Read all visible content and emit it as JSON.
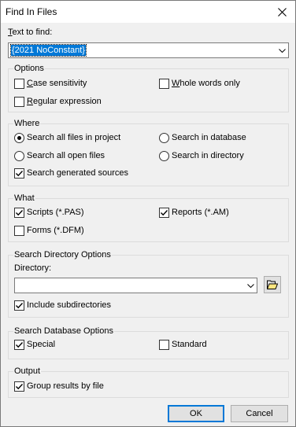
{
  "window": {
    "title": "Find In Files"
  },
  "find": {
    "label_prefix": "",
    "label_ul": "T",
    "label_rest": "ext to find:",
    "value": "{2021 NoConstant}"
  },
  "options": {
    "title": "Options",
    "case": {
      "ul": "C",
      "rest": "ase sensitivity",
      "checked": false
    },
    "whole": {
      "ul": "W",
      "rest": "hole words only",
      "checked": false
    },
    "regex": {
      "ul": "R",
      "rest": "egular expression",
      "checked": false
    }
  },
  "where": {
    "title": "Where",
    "all_project": {
      "label": "Search all files in project",
      "selected": true
    },
    "open_files": {
      "label": "Search all open files",
      "selected": false
    },
    "generated": {
      "label": "Search generated sources",
      "checked": true
    },
    "database": {
      "label": "Search in database",
      "selected": false
    },
    "directory": {
      "label": "Search in directory",
      "selected": false
    }
  },
  "what": {
    "title": "What",
    "scripts": {
      "label": "Scripts (*.PAS)",
      "checked": true
    },
    "reports": {
      "label": "Reports (*.AM)",
      "checked": true
    },
    "forms": {
      "label": "Forms (*.DFM)",
      "checked": false
    }
  },
  "search_dir": {
    "title": "Search Directory Options",
    "dir_label": "Directory:",
    "dir_value": "",
    "include_sub": {
      "label": "Include subdirectories",
      "checked": true
    }
  },
  "search_db": {
    "title": "Search Database Options",
    "special": {
      "label": "Special",
      "checked": true
    },
    "standard": {
      "label": "Standard",
      "checked": false
    }
  },
  "output": {
    "title": "Output",
    "group_by_file": {
      "label": "Group results by file",
      "checked": true
    }
  },
  "buttons": {
    "ok": "OK",
    "cancel": "Cancel"
  },
  "icons": {
    "close": "close-icon",
    "dropdown": "chevron-down-icon",
    "folder": "folder-open-icon"
  }
}
